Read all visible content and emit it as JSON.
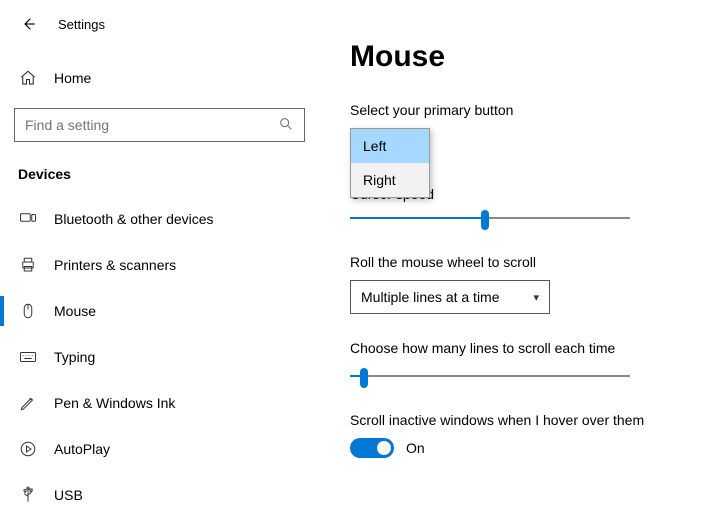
{
  "header": {
    "title": "Settings"
  },
  "home": {
    "label": "Home"
  },
  "search": {
    "placeholder": "Find a setting"
  },
  "section": {
    "label": "Devices"
  },
  "nav": [
    {
      "label": "Bluetooth & other devices"
    },
    {
      "label": "Printers & scanners"
    },
    {
      "label": "Mouse"
    },
    {
      "label": "Typing"
    },
    {
      "label": "Pen & Windows Ink"
    },
    {
      "label": "AutoPlay"
    },
    {
      "label": "USB"
    }
  ],
  "page": {
    "title": "Mouse",
    "primary_btn": {
      "label": "Select your primary button",
      "options": {
        "left": "Left",
        "right": "Right"
      }
    },
    "cursor_speed": {
      "label": "Cursor speed"
    },
    "scroll_wheel": {
      "label": "Roll the mouse wheel to scroll",
      "value": "Multiple lines at a time"
    },
    "lines": {
      "label": "Choose how many lines to scroll each time"
    },
    "inactive": {
      "label": "Scroll inactive windows when I hover over them",
      "state": "On"
    }
  }
}
